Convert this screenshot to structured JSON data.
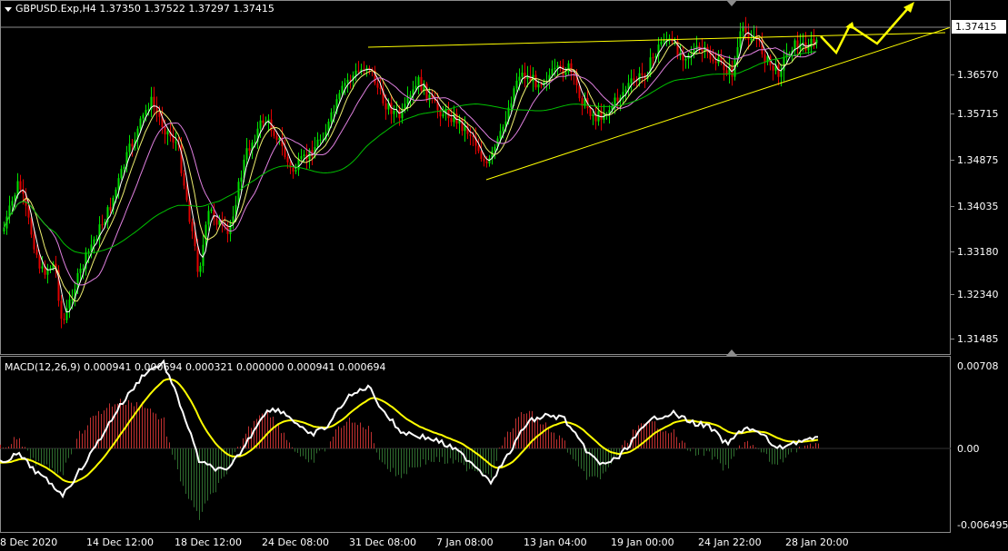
{
  "window": {
    "symbol_header": "GBPUSD.Exp,H4  1.37350 1.37522 1.37297 1.37415",
    "current_price": "1.37415"
  },
  "price_axis": [
    "1.36570",
    "1.35715",
    "1.34875",
    "1.34035",
    "1.33180",
    "1.32340",
    "1.31485"
  ],
  "macd": {
    "header": "MACD(12,26,9) 0.000941 0.000694 0.000321 0.000000 0.000941 0.000694",
    "axis": [
      "0.00708",
      "0.00",
      "-0.006495"
    ]
  },
  "time_axis": [
    "8 Dec 2020",
    "14 Dec 12:00",
    "18 Dec 12:00",
    "24 Dec 08:00",
    "31 Dec 08:00",
    "7 Jan 08:00",
    "13 Jan 04:00",
    "19 Jan 00:00",
    "24 Jan 22:00",
    "28 Jan 20:00"
  ],
  "colors": {
    "background": "#000000",
    "bull_candle": "#00e000",
    "bear_candle": "#e00000",
    "trendline": "#ffff00",
    "ma_white": "#ffffff",
    "ma_yellow": "#f0f070",
    "ma_pink": "#e080e0",
    "ma_green": "#00c000",
    "macd_hist_pos": "#c03030",
    "macd_hist_neg": "#2e6b2e",
    "macd_line": "#ffffff",
    "signal_line": "#ffff00",
    "forecast_arrow": "#ffff00"
  }
}
